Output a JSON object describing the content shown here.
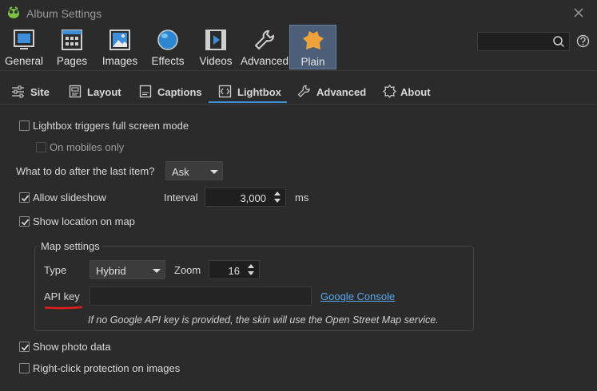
{
  "window": {
    "title": "Album Settings"
  },
  "toolbar": {
    "items": [
      {
        "label": "General",
        "icon": "monitor-icon"
      },
      {
        "label": "Pages",
        "icon": "grid-page-icon"
      },
      {
        "label": "Images",
        "icon": "image-icon"
      },
      {
        "label": "Effects",
        "icon": "sphere-icon"
      },
      {
        "label": "Videos",
        "icon": "film-icon"
      },
      {
        "label": "Advanced",
        "icon": "wrench-icon"
      },
      {
        "label": "Plain",
        "icon": "leather-icon",
        "active": true
      }
    ],
    "search_value": ""
  },
  "subtabs": [
    {
      "label": "Site",
      "icon": "sliders-icon"
    },
    {
      "label": "Layout",
      "icon": "layout-icon"
    },
    {
      "label": "Captions",
      "icon": "caption-icon"
    },
    {
      "label": "Lightbox",
      "icon": "lightbox-icon",
      "active": true
    },
    {
      "label": "Advanced",
      "icon": "wrench-icon"
    },
    {
      "label": "About",
      "icon": "badge-icon"
    }
  ],
  "lightbox": {
    "fullscreen": {
      "label": "Lightbox triggers full screen mode",
      "checked": false
    },
    "mobiles_only": {
      "label": "On mobiles only",
      "checked": false,
      "disabled": true
    },
    "after_last": {
      "label": "What to do after the last item?",
      "value": "Ask"
    },
    "slideshow": {
      "label": "Allow slideshow",
      "checked": true
    },
    "interval": {
      "label": "Interval",
      "value": "3,000",
      "unit": "ms"
    },
    "location": {
      "label": "Show location on map",
      "checked": true
    },
    "map": {
      "group_title": "Map settings",
      "type_label": "Type",
      "type_value": "Hybrid",
      "zoom_label": "Zoom",
      "zoom_value": "16",
      "api_label": "API key",
      "api_value": "",
      "link": "Google Console",
      "note": "If no Google API key is provided, the skin will use the Open Street Map service."
    },
    "photo_data": {
      "label": "Show photo data",
      "checked": true
    },
    "right_click": {
      "label": "Right-click protection on images",
      "checked": false
    }
  },
  "colors": {
    "background": "#2b2b2b",
    "active_tab": "#4d5e79",
    "accent": "#3f8fd8",
    "link": "#5aa8f0",
    "annotation": "#e0201c"
  }
}
